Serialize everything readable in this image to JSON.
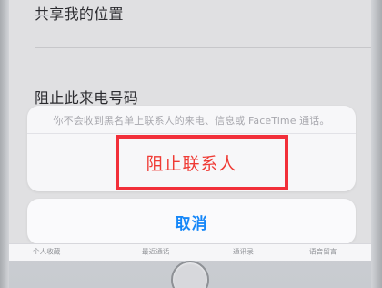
{
  "settings": {
    "share_location": "共享我的位置",
    "block_caller": "阻止此来电号码"
  },
  "action_sheet": {
    "message": "你不会收到黑名单上联系人的来电、信息或 FaceTime 通话。",
    "primary_action": "阻止联系人",
    "cancel_label": "取消"
  },
  "tabbar": {
    "items": [
      "个人收藏",
      "最近通话",
      "通讯录",
      "语音留言"
    ]
  },
  "colors": {
    "destructive": "#ef3b35",
    "accent": "#1687f8",
    "highlight": "#f22f3a"
  }
}
